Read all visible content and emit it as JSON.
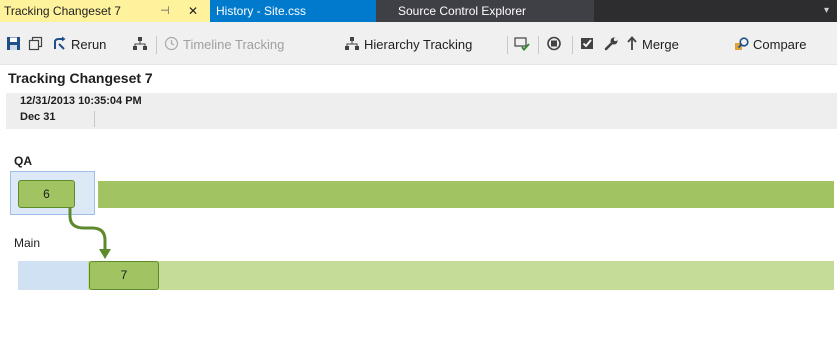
{
  "tabs": {
    "active": {
      "label": "Tracking Changeset 7",
      "pin": "⊣",
      "close": "✕"
    },
    "history": {
      "label": "History - Site.css"
    },
    "source": {
      "label": "Source Control Explorer"
    },
    "overflow": "▾"
  },
  "toolbar": {
    "rerun": "Rerun",
    "timeline": "Timeline Tracking",
    "hierarchy": "Hierarchy Tracking",
    "merge": "Merge",
    "compare": "Compare"
  },
  "page": {
    "title": "Tracking Changeset 7",
    "datetime": "12/31/2013 10:35:04 PM",
    "day": "Dec 31"
  },
  "branches": {
    "qa": {
      "name": "QA",
      "changeset": "6"
    },
    "main": {
      "name": "Main",
      "changeset": "7"
    }
  },
  "colors": {
    "active_tab": "#fff29d",
    "history_tab": "#007acc",
    "lane_qa": "#a1c361",
    "lane_main": "#c5dc98",
    "arrow": "#5f8a2c"
  }
}
